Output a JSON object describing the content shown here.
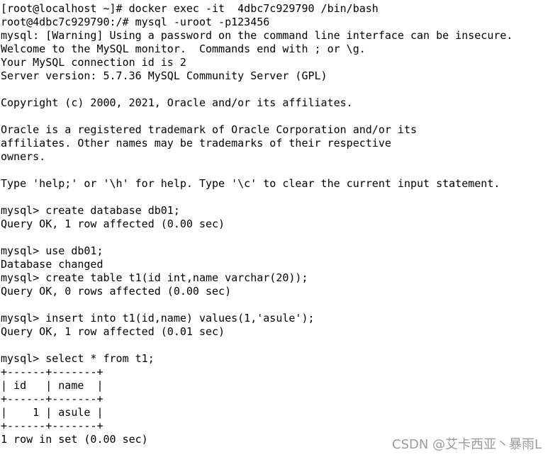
{
  "terminal": {
    "lines": [
      "[root@localhost ~]# docker exec -it  4dbc7c929790 /bin/bash",
      "root@4dbc7c929790:/# mysql -uroot -p123456",
      "mysql: [Warning] Using a password on the command line interface can be insecure.",
      "Welcome to the MySQL monitor.  Commands end with ; or \\g.",
      "Your MySQL connection id is 2",
      "Server version: 5.7.36 MySQL Community Server (GPL)",
      "",
      "Copyright (c) 2000, 2021, Oracle and/or its affiliates.",
      "",
      "Oracle is a registered trademark of Oracle Corporation and/or its",
      "affiliates. Other names may be trademarks of their respective",
      "owners.",
      "",
      "Type 'help;' or '\\h' for help. Type '\\c' to clear the current input statement.",
      "",
      "mysql> create database db01;",
      "Query OK, 1 row affected (0.00 sec)",
      "",
      "mysql> use db01;",
      "Database changed",
      "mysql> create table t1(id int,name varchar(20));",
      "Query OK, 0 rows affected (0.00 sec)",
      "",
      "mysql> insert into t1(id,name) values(1,'asule');",
      "Query OK, 1 row affected (0.01 sec)",
      "",
      "mysql> select * from t1;",
      "+------+-------+",
      "| id   | name  |",
      "+------+-------+",
      "|    1 | asule |",
      "+------+-------+",
      "1 row in set (0.00 sec)"
    ]
  },
  "watermark": "CSDN @艾卡西亚丶暴雨L"
}
